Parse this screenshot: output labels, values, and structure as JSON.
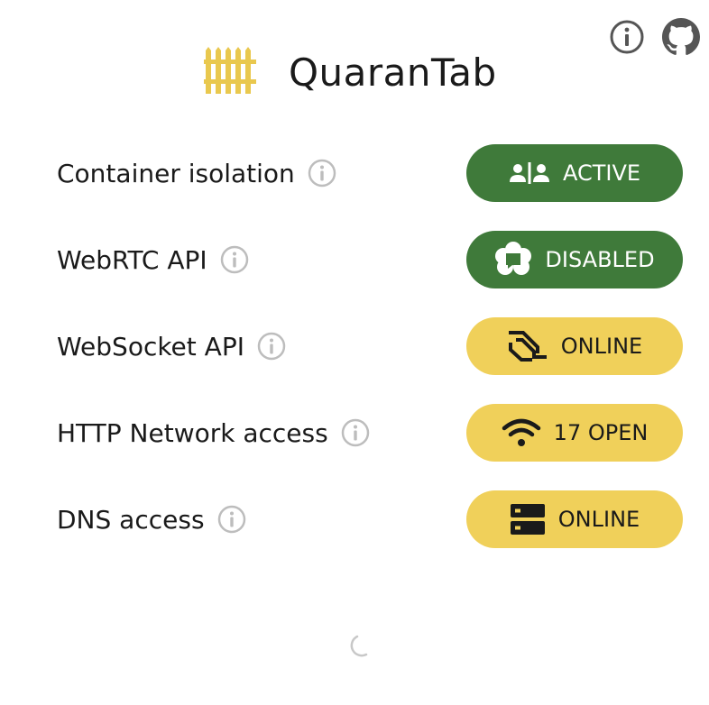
{
  "app": {
    "title": "QuaranTab",
    "logo_icon": "fence-icon",
    "logo_color": "#e9c84e"
  },
  "top_icons": [
    {
      "name": "info-icon"
    },
    {
      "name": "github-icon"
    }
  ],
  "rows": [
    {
      "label": "Container isolation",
      "status": "ACTIVE",
      "status_icon": "users-divider-icon",
      "style": "green"
    },
    {
      "label": "WebRTC API",
      "status": "DISABLED",
      "status_icon": "webrtc-icon",
      "style": "green"
    },
    {
      "label": "WebSocket API",
      "status": "ONLINE",
      "status_icon": "websocket-icon",
      "style": "yellow"
    },
    {
      "label": "HTTP Network access",
      "status": "17 OPEN",
      "status_icon": "wifi-icon",
      "style": "yellow"
    },
    {
      "label": "DNS access",
      "status": "ONLINE",
      "status_icon": "server-icon",
      "style": "yellow"
    }
  ],
  "colors": {
    "green": "#3f7a3a",
    "yellow": "#f0d05a",
    "icon_gray": "#bdbdbd"
  }
}
